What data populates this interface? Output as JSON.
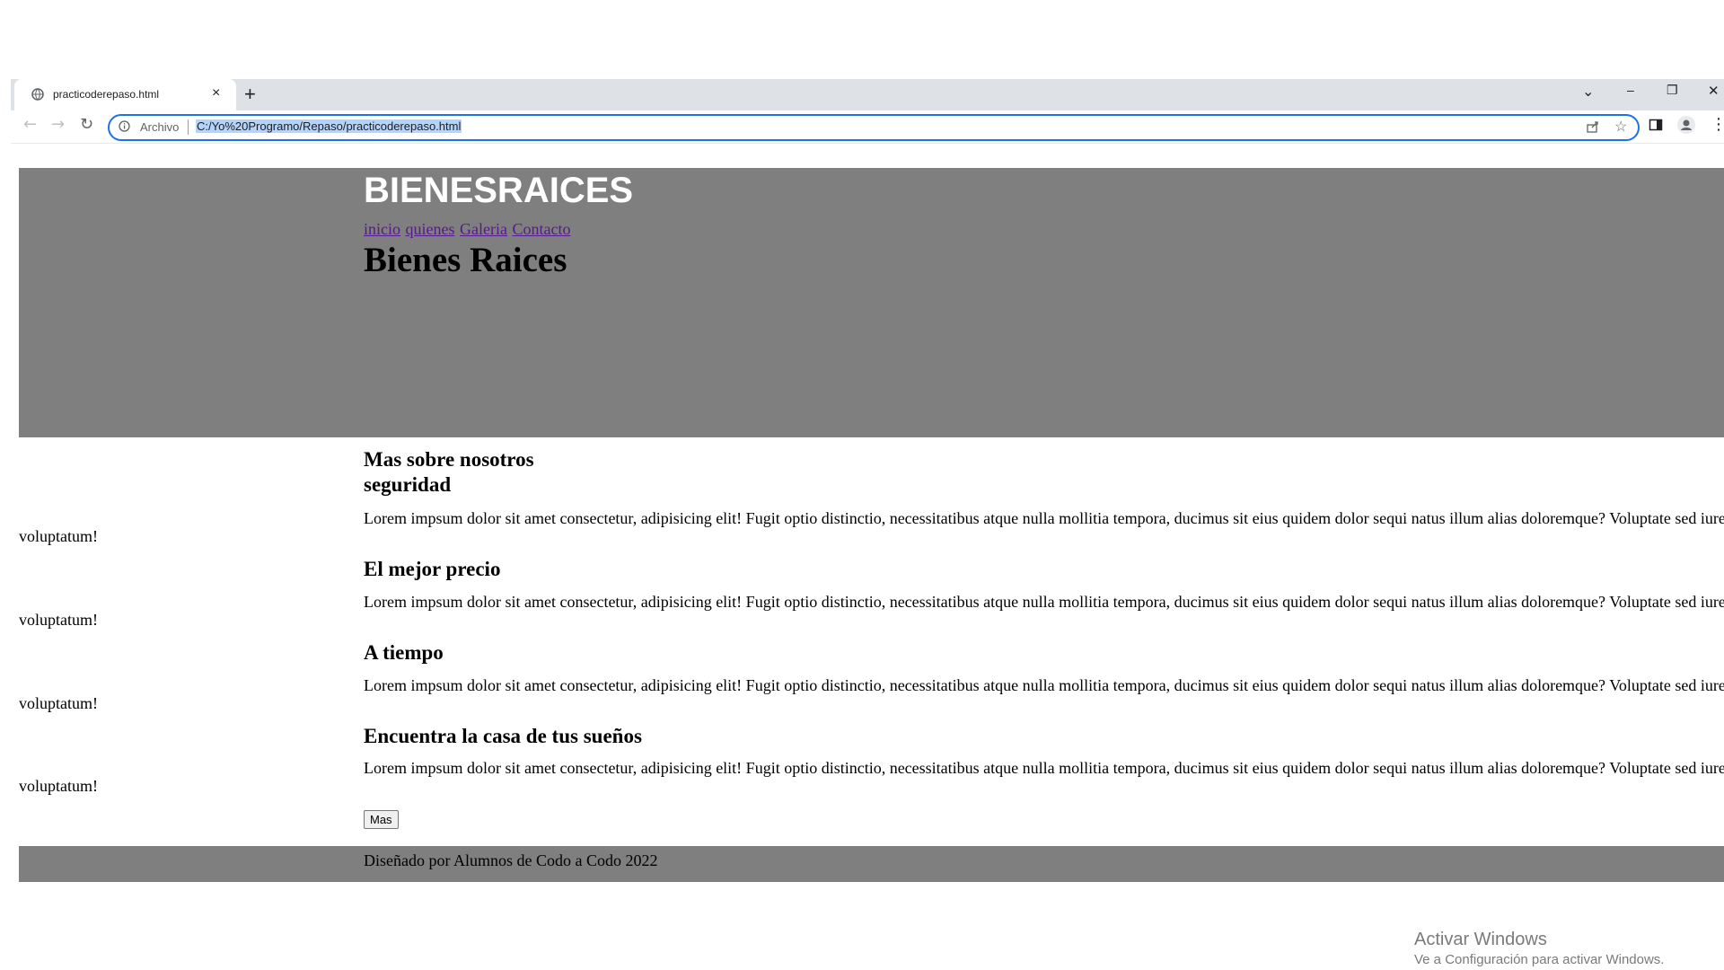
{
  "browser": {
    "tab_title": "practicoderepaso.html",
    "new_tab_symbol": "+",
    "omnibox": {
      "security_label": "Archivo",
      "url": "C:/Yo%20Programo/Repaso/practicoderepaso.html"
    },
    "window_controls": {
      "list": "⌄",
      "minimize": "–",
      "restore": "❐",
      "close": "✕"
    },
    "nav": {
      "back": "←",
      "forward": "→",
      "reload": "↻"
    },
    "menu_symbol": "⋮"
  },
  "page": {
    "brand": "BIENESRAICES",
    "nav_links": [
      "inicio",
      "quienes",
      "Galeria",
      "Contacto"
    ],
    "hero_title": "Bienes Raices",
    "sections": [
      {
        "titles": [
          "Mas sobre nosotros",
          "seguridad"
        ],
        "text_line1": "Lorem impsum dolor sit amet consectetur, adipisicing elit! Fugit optio distinctio, necessitatibus atque nulla mollitia tempora, ducimus sit eius quidem dolor sequi natus illum alias doloremque? Voluptate sed iure",
        "text_line2": "voluptatum!"
      },
      {
        "titles": [
          "El mejor precio"
        ],
        "text_line1": "Lorem impsum dolor sit amet consectetur, adipisicing elit! Fugit optio distinctio, necessitatibus atque nulla mollitia tempora, ducimus sit eius quidem dolor sequi natus illum alias doloremque? Voluptate sed iure",
        "text_line2": "voluptatum!"
      },
      {
        "titles": [
          "A tiempo"
        ],
        "text_line1": "Lorem impsum dolor sit amet consectetur, adipisicing elit! Fugit optio distinctio, necessitatibus atque nulla mollitia tempora, ducimus sit eius quidem dolor sequi natus illum alias doloremque? Voluptate sed iure",
        "text_line2": "voluptatum!"
      },
      {
        "titles": [
          "Encuentra la casa de tus sueños"
        ],
        "text_line1": "Lorem impsum dolor sit amet consectetur, adipisicing elit! Fugit optio distinctio, necessitatibus atque nulla mollitia tempora, ducimus sit eius quidem dolor sequi natus illum alias doloremque? Voluptate sed iure",
        "text_line2": "voluptatum!"
      }
    ],
    "button_label": "Mas",
    "footer": "Diseñado por Alumnos de Codo a Codo 2022"
  },
  "os_overlay": {
    "title": "Activar Windows",
    "subtitle": "Ve a Configuración para activar Windows."
  },
  "colors": {
    "hero_bg": "#7f7f7f",
    "brand_text": "#ffffff",
    "visited_link": "#551a8b",
    "omnibox_focus": "#1a73e8",
    "tabstrip_bg": "#dee1e6"
  }
}
